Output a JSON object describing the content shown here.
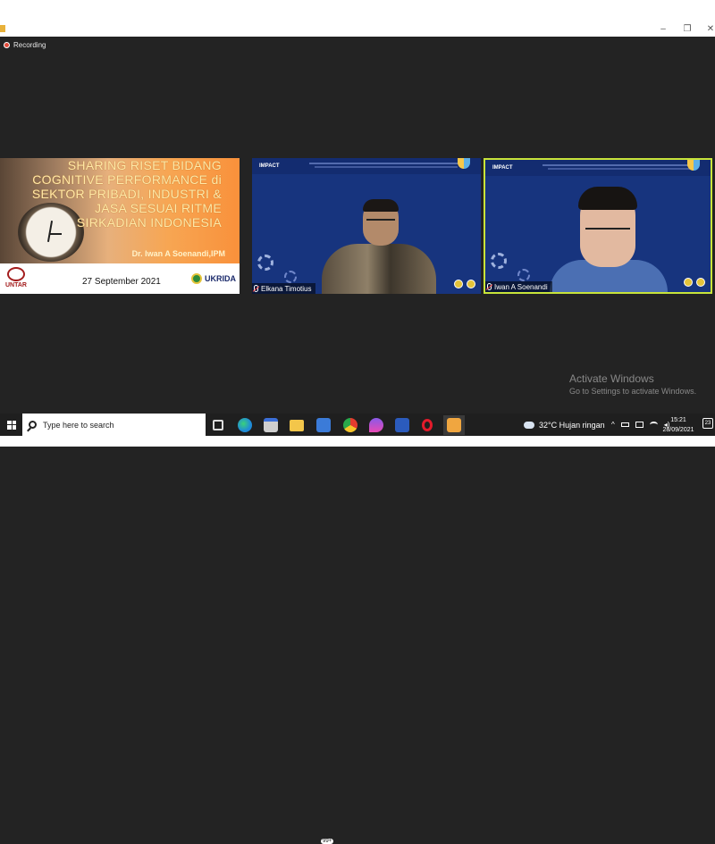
{
  "window": {
    "controls": {
      "minimize": "–",
      "restore": "❐",
      "close": "✕"
    }
  },
  "recording": {
    "label": "Recording"
  },
  "presentation": {
    "title": "SHARING RISET BIDANG COGNITIVE PERFORMANCE di SEKTOR PRIBADI, INDUSTRI & JASA SESUAI RITME SIRKADIAN INDONESIA",
    "author": "Dr. Iwan A Soenandi,IPM",
    "date": "27 September 2021",
    "logo_left": "UNTAR",
    "logo_right": "UKRIDA"
  },
  "participants": [
    {
      "name": "Elkana Timotius",
      "banner": "IMPACT",
      "active": false
    },
    {
      "name": "Iwan A Soenandi",
      "banner": "IMPACT",
      "active": true
    }
  ],
  "activation": {
    "title": "Activate Windows",
    "subtitle": "Go to Settings to activate Windows."
  },
  "taskbar": {
    "search_placeholder": "Type here to search",
    "mail_badge": "99+",
    "weather": "32°C  Hujan ringan",
    "time": "15:21",
    "date": "28/09/2021",
    "notifications": "23"
  },
  "colors": {
    "background": "#232323",
    "camera_bg": "#17347e",
    "active_speaker_border": "#c8e43a",
    "slide_title": "#ffe9a8"
  }
}
